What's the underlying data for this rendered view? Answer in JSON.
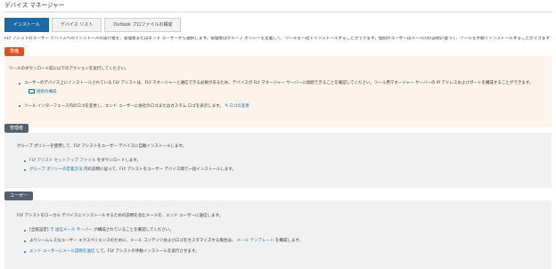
{
  "page": {
    "title": "デバイス マネージャー"
  },
  "tabs": [
    {
      "label": "インストール",
      "active": true
    },
    {
      "label": "デバイス リスト",
      "active": false
    },
    {
      "label": "Outlook プロファイルの構成",
      "active": false
    }
  ],
  "intro": "FLY アシストのユーザー デバイスへのインストールの実行者を、管理者またはエンド ユーザーから選択します。管理者はグループ ポリシーを定義して、ツールを一括でインストールすることができます。個別のユーザーはメール内の説明に従って、ツールを手動でインストールすることができます。",
  "sections": {
    "prep": {
      "label": "準備",
      "heading": "ツールのダウンロード前に以下のアクションを実行してください。",
      "bullet1": "ユーザーのデバイス上にインストールされている FLY アシストは、FLY マネージャーと通信できる必要があるため、デバイスが FLY マネージャー サーバーに接続できることを確認してください。ツール用マネージャー サーバーの IP アドレスおよびポートを構成することができます。",
      "connection_link": "接続の構成",
      "bullet2": "ツール インターフェース内のロゴを変更し、エンド ユーザーに会社のロゴまたはカスタム ロゴを表示します。",
      "logo_link": "ロゴの変更"
    },
    "admin": {
      "label": "管理者",
      "heading": "グループ ポリシーを使用して、FLY アシストをユーザー デバイスに自動インストールします。",
      "bullet1_link": "FLY アシスト セットアップ ファイル",
      "bullet1_text": "をダウンロードします。",
      "bullet2_link": "グループ ポリシーの定義方法",
      "bullet2_text": "内の説明に従って、FLY アシストをユーザー デバイス間で一括インストールします。"
    },
    "user": {
      "label": "ユーザー",
      "heading": "FLY アシストをローカル デバイスにインストールするための説明を含むメールを、エンド ユーザーに送信します。",
      "bullet1_pre": "[全般設定] で",
      "bullet1_link": "送信メール サーバー",
      "bullet1_post": "が構成されていることを確認してください。",
      "bullet2_pre": "よりシームレスなユーザー エクスペリエンスのために、メール コンテンツおよびロゴをカスタマイズする場合は、",
      "bullet2_link": "メール テンプレート",
      "bullet2_post": "を構成します。",
      "bullet3_link": "エンド ユーザーにメール説明を送信",
      "bullet3_post": "して、FLY アシストの手動インストールを実行させます。"
    }
  }
}
